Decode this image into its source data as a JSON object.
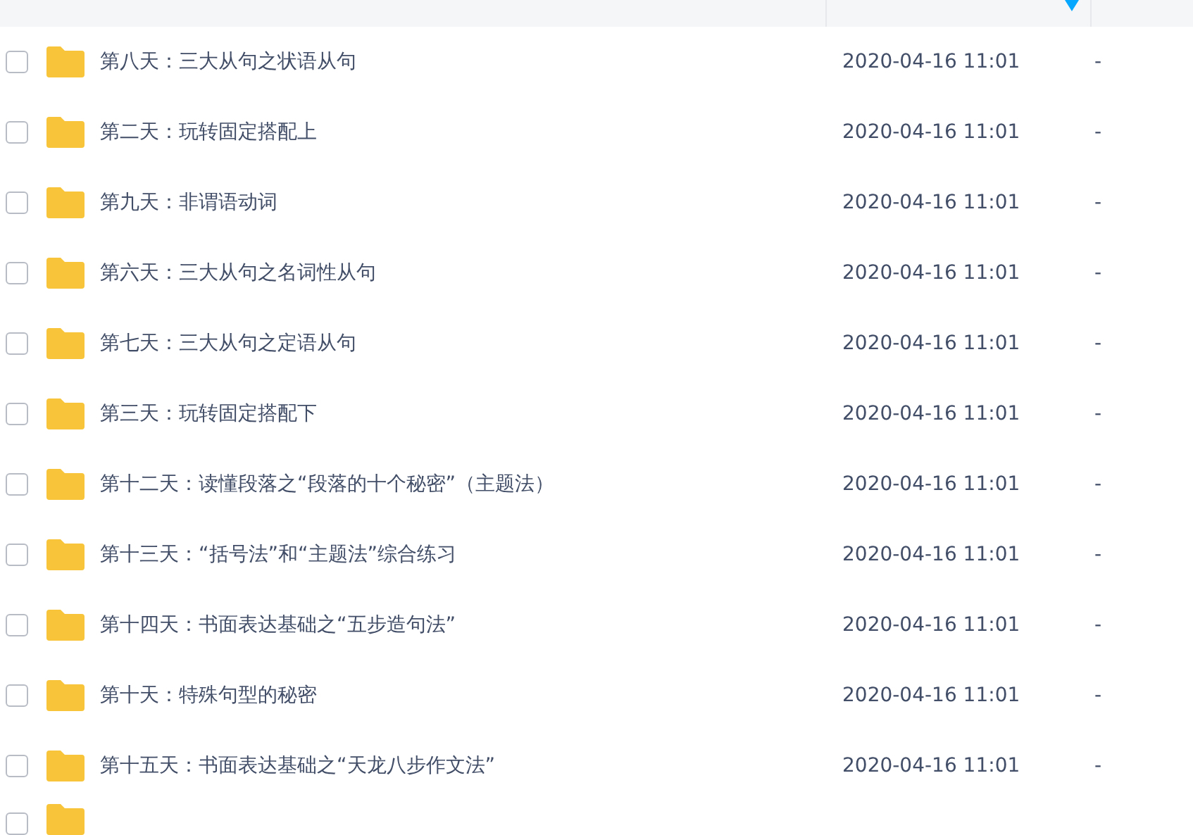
{
  "header": {
    "sort_indicator": true
  },
  "rows": [
    {
      "name": "第八天：三大从句之状语从句",
      "modified": "2020-04-16 11:01",
      "size": "-",
      "checked": false
    },
    {
      "name": "第二天：玩转固定搭配上",
      "modified": "2020-04-16 11:01",
      "size": "-",
      "checked": false
    },
    {
      "name": "第九天：非谓语动词",
      "modified": "2020-04-16 11:01",
      "size": "-",
      "checked": false
    },
    {
      "name": "第六天：三大从句之名词性从句",
      "modified": "2020-04-16 11:01",
      "size": "-",
      "checked": false
    },
    {
      "name": "第七天：三大从句之定语从句",
      "modified": "2020-04-16 11:01",
      "size": "-",
      "checked": false
    },
    {
      "name": "第三天：玩转固定搭配下",
      "modified": "2020-04-16 11:01",
      "size": "-",
      "checked": false
    },
    {
      "name": "第十二天：读懂段落之“段落的十个秘密”（主题法）",
      "modified": "2020-04-16 11:01",
      "size": "-",
      "checked": false
    },
    {
      "name": "第十三天：“括号法”和“主题法”综合练习",
      "modified": "2020-04-16 11:01",
      "size": "-",
      "checked": false
    },
    {
      "name": "第十四天：书面表达基础之“五步造句法”",
      "modified": "2020-04-16 11:01",
      "size": "-",
      "checked": false
    },
    {
      "name": "第十天：特殊句型的秘密",
      "modified": "2020-04-16 11:01",
      "size": "-",
      "checked": false
    },
    {
      "name": "第十五天：书面表达基础之“天龙八步作文法”",
      "modified": "2020-04-16 11:01",
      "size": "-",
      "checked": false
    },
    {
      "checked": false
    }
  ]
}
